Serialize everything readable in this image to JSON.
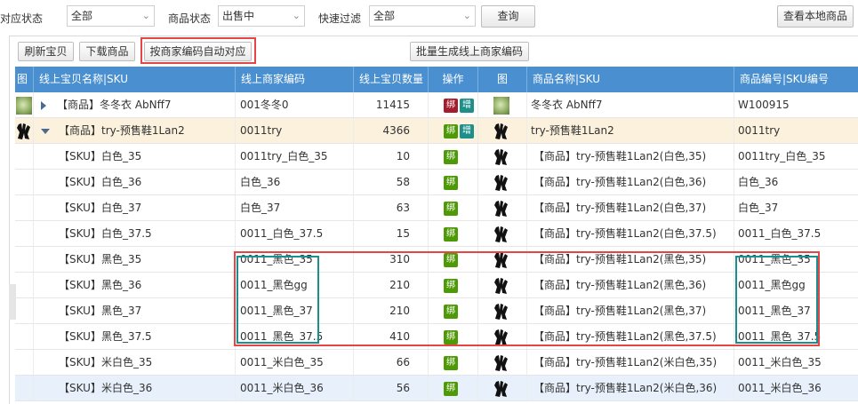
{
  "filters": {
    "status_label": "对应状态",
    "status_value": "全部",
    "goods_status_label": "商品状态",
    "goods_status_value": "出售中",
    "quick_label": "快速过滤",
    "quick_value": "全部",
    "query_button": "查询",
    "local_goods_button": "查看本地商品"
  },
  "toolbar": {
    "refresh": "刷新宝贝",
    "download": "下载商品",
    "auto_match": "按商家编码自动对应",
    "batch_generate": "批量生成线上商家编码"
  },
  "columns": [
    "图",
    "线上宝贝名称|SKU",
    "线上商家编码",
    "线上宝贝数量",
    "操作",
    "图",
    "商品名称|SKU",
    "商品编号|SKU编号"
  ],
  "colors": {
    "header": "#4a8fd0",
    "bind_red": "#a51d2d",
    "bind_green": "#4e9a06",
    "add_teal": "#1f8f8a",
    "selected_row": "#fbf1dd",
    "hover_row": "#e8f1fb"
  },
  "rows": [
    {
      "name": "【商品】冬冬衣 AbNff7",
      "code": "001冬冬0",
      "qty": "11415",
      "ops": [
        {
          "label": "绑",
          "kind": "bind_red"
        },
        {
          "label": "增",
          "kind": "add"
        }
      ],
      "goods_name": "冬冬衣 AbNff7",
      "goods_no": "W100915",
      "level": 0,
      "expander": "collapsed",
      "thumb": "green",
      "state": "normal"
    },
    {
      "name": "【商品】try-预售鞋1Lan2",
      "code": "0011try",
      "qty": "4366",
      "ops": [
        {
          "label": "绑",
          "kind": "bind_green"
        },
        {
          "label": "增",
          "kind": "add"
        }
      ],
      "goods_name": "try-预售鞋1Lan2",
      "goods_no": "0011try",
      "level": 0,
      "expander": "expanded",
      "thumb": "black",
      "state": "selected"
    },
    {
      "name": "【SKU】白色_35",
      "code": "0011try_白色_35",
      "qty": "10",
      "ops": [
        {
          "label": "绑",
          "kind": "bind_green"
        }
      ],
      "goods_name": "【商品】try-预售鞋1Lan2(白色,35)",
      "goods_no": "0011try_白色_35",
      "level": 1,
      "thumb": "black",
      "state": "normal"
    },
    {
      "name": "【SKU】白色_36",
      "code": "白色_36",
      "qty": "58",
      "ops": [
        {
          "label": "绑",
          "kind": "bind_green"
        }
      ],
      "goods_name": "【商品】try-预售鞋1Lan2(白色,36)",
      "goods_no": "白色_36",
      "level": 1,
      "thumb": "black",
      "state": "normal"
    },
    {
      "name": "【SKU】白色_37",
      "code": "白色_37",
      "qty": "63",
      "ops": [
        {
          "label": "绑",
          "kind": "bind_green"
        }
      ],
      "goods_name": "【商品】try-预售鞋1Lan2(白色,37)",
      "goods_no": "白色_37",
      "level": 1,
      "thumb": "black",
      "state": "normal"
    },
    {
      "name": "【SKU】白色_37.5",
      "code": "0011_白色_37.5",
      "qty": "15",
      "ops": [
        {
          "label": "绑",
          "kind": "bind_green"
        }
      ],
      "goods_name": "【商品】try-预售鞋1Lan2(白色,37.5)",
      "goods_no": "0011_白色_37.5",
      "level": 1,
      "thumb": "black",
      "state": "normal"
    },
    {
      "name": "【SKU】黑色_35",
      "code": "0011_黑色_35",
      "qty": "310",
      "ops": [
        {
          "label": "绑",
          "kind": "bind_green"
        }
      ],
      "goods_name": "【商品】try-预售鞋1Lan2(黑色,35)",
      "goods_no": "0011_黑色_35",
      "level": 1,
      "thumb": "black",
      "state": "normal"
    },
    {
      "name": "【SKU】黑色_36",
      "code": "0011_黑色gg",
      "qty": "210",
      "ops": [
        {
          "label": "绑",
          "kind": "bind_green"
        }
      ],
      "goods_name": "【商品】try-预售鞋1Lan2(黑色,36)",
      "goods_no": "0011_黑色gg",
      "level": 1,
      "thumb": "black",
      "state": "normal"
    },
    {
      "name": "【SKU】黑色_37",
      "code": "0011_黑色_37",
      "qty": "210",
      "ops": [
        {
          "label": "绑",
          "kind": "bind_green"
        }
      ],
      "goods_name": "【商品】try-预售鞋1Lan2(黑色,37)",
      "goods_no": "0011_黑色_37",
      "level": 1,
      "thumb": "black",
      "state": "normal"
    },
    {
      "name": "【SKU】黑色_37.5",
      "code": "0011_黑色_37.5",
      "qty": "410",
      "ops": [
        {
          "label": "绑",
          "kind": "bind_green"
        }
      ],
      "goods_name": "【商品】try-预售鞋1Lan2(黑色,37.5)",
      "goods_no": "0011_黑色_37.5",
      "level": 1,
      "thumb": "black",
      "state": "normal"
    },
    {
      "name": "【SKU】米白色_35",
      "code": "0011_米白色_35",
      "qty": "66",
      "ops": [
        {
          "label": "绑",
          "kind": "bind_green"
        }
      ],
      "goods_name": "【商品】try-预售鞋1Lan2(米白色,35)",
      "goods_no": "0011_米白色_35",
      "level": 1,
      "thumb": "black",
      "state": "normal"
    },
    {
      "name": "【SKU】米白色_36",
      "code": "0011_米白色_36",
      "qty": "56",
      "ops": [
        {
          "label": "绑",
          "kind": "bind_green"
        }
      ],
      "goods_name": "【商品】try-预售鞋1Lan2(米白色,36)",
      "goods_no": "0011_米白色_36",
      "level": 1,
      "thumb": "black",
      "state": "hover"
    }
  ]
}
